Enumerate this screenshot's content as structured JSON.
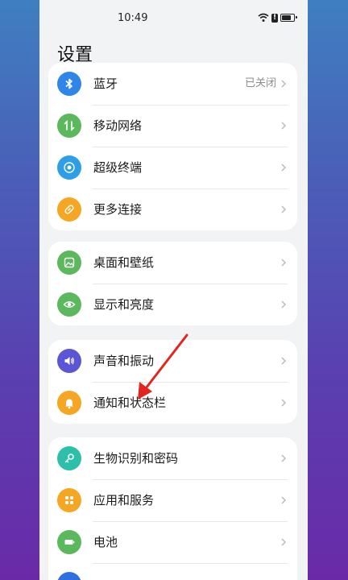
{
  "status_bar": {
    "time": "10:49"
  },
  "page": {
    "title": "设置"
  },
  "groups": [
    {
      "items": [
        {
          "label": "蓝牙",
          "value": "已关闭",
          "icon": "bluetooth-icon",
          "color": "#2f86e8"
        },
        {
          "label": "移动网络",
          "value": "",
          "icon": "mobile-network-icon",
          "color": "#5cb85c"
        },
        {
          "label": "超级终端",
          "value": "",
          "icon": "super-device-icon",
          "color": "#2e9ee6"
        },
        {
          "label": "更多连接",
          "value": "",
          "icon": "link-icon",
          "color": "#f5a623"
        }
      ]
    },
    {
      "items": [
        {
          "label": "桌面和壁纸",
          "value": "",
          "icon": "wallpaper-icon",
          "color": "#5cb85c"
        },
        {
          "label": "显示和亮度",
          "value": "",
          "icon": "eye-icon",
          "color": "#5cb85c"
        }
      ]
    },
    {
      "items": [
        {
          "label": "声音和振动",
          "value": "",
          "icon": "speaker-icon",
          "color": "#5a56d6"
        },
        {
          "label": "通知和状态栏",
          "value": "",
          "icon": "bell-icon",
          "color": "#f5a623"
        }
      ]
    },
    {
      "items": [
        {
          "label": "生物识别和密码",
          "value": "",
          "icon": "key-icon",
          "color": "#2dbfa8"
        },
        {
          "label": "应用和服务",
          "value": "",
          "icon": "apps-icon",
          "color": "#f5a623"
        },
        {
          "label": "电池",
          "value": "",
          "icon": "battery-icon",
          "color": "#5cb85c"
        }
      ]
    }
  ],
  "annotation": {
    "arrow_color": "#e0261f"
  }
}
